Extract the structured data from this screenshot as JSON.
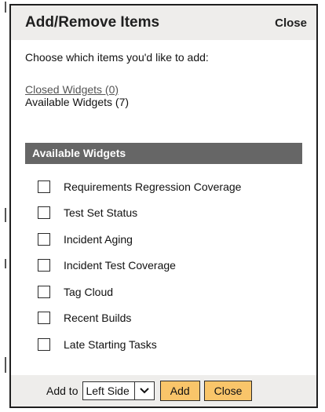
{
  "dialog": {
    "title": "Add/Remove Items",
    "close_label": "Close"
  },
  "intro_text": "Choose which items you'd like to add:",
  "links": {
    "closed_widgets": "Closed Widgets (0)",
    "available_widgets": "Available Widgets (7)"
  },
  "section_header": "Available Widgets",
  "items": [
    {
      "label": "Requirements Regression Coverage",
      "checked": false
    },
    {
      "label": "Test Set Status",
      "checked": false
    },
    {
      "label": "Incident Aging",
      "checked": false
    },
    {
      "label": "Incident Test Coverage",
      "checked": false
    },
    {
      "label": "Tag Cloud",
      "checked": false
    },
    {
      "label": "Recent Builds",
      "checked": false
    },
    {
      "label": "Late Starting Tasks",
      "checked": false
    }
  ],
  "footer": {
    "add_to_label": "Add to",
    "location_select": {
      "selected": "Left Side"
    },
    "add_button": "Add",
    "close_button": "Close"
  },
  "colors": {
    "section_header_bg": "#666666",
    "button_bg": "#f9c56a",
    "titlebar_bg": "#eeedeb"
  },
  "icons": {
    "select_arrow": "chevron-down-icon"
  }
}
